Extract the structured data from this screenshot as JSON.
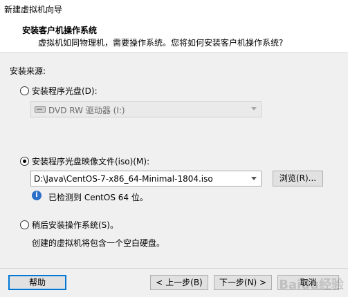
{
  "window": {
    "title": "新建虚拟机向导"
  },
  "header": {
    "title": "安装客户机操作系统",
    "subtitle": "虚拟机如同物理机，需要操作系统。您将如何安装客户机操作系统?"
  },
  "install_source": {
    "label": "安装来源:",
    "options": [
      {
        "label": "安装程序光盘(D):",
        "selected": false
      },
      {
        "label": "安装程序光盘映像文件(iso)(M):",
        "selected": true
      },
      {
        "label": "稍后安装操作系统(S)。",
        "selected": false
      }
    ],
    "disc_combo": {
      "value": "DVD RW 驱动器 (I:)"
    },
    "iso_combo": {
      "value": "D:\\Java\\CentOS-7-x86_64-Minimal-1804.iso"
    },
    "browse_label": "浏览(R)...",
    "detected_text": "已检测到 CentOS 64 位。",
    "later_desc": "创建的虚拟机将包含一个空白硬盘。"
  },
  "footer": {
    "help": "帮助",
    "back": "< 上一步(B)",
    "next": "下一步(N) >",
    "cancel": "取消"
  },
  "watermark": "Baidu经验",
  "colors": {
    "accent": "#0078d7",
    "info": "#2b6fc8"
  }
}
